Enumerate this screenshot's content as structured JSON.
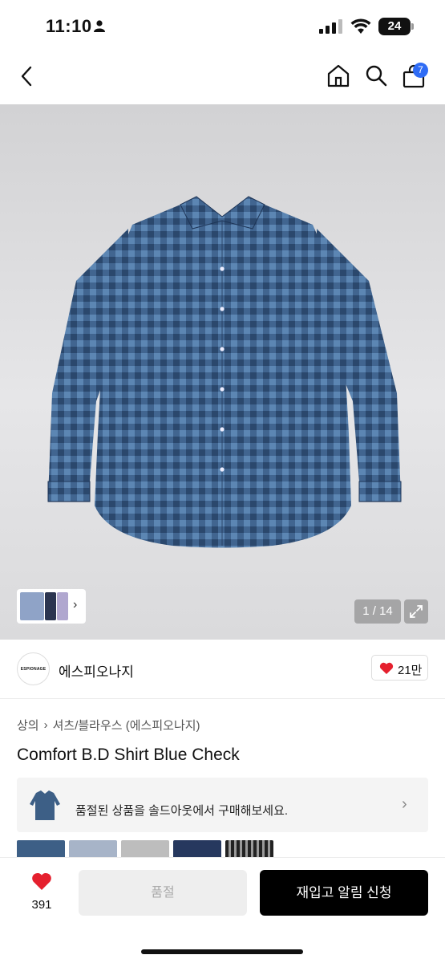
{
  "status_bar": {
    "time": "11:10",
    "battery": "24"
  },
  "nav": {
    "cart_badge": "7"
  },
  "gallery": {
    "counter": "1 / 14"
  },
  "brand": {
    "logo_text": "ESPIONAGE",
    "name": "에스피오나지",
    "likes": "21만"
  },
  "breadcrumb": {
    "level1": "상의",
    "level2": "셔츠/블라우스 (에스피오나지)"
  },
  "product": {
    "title": "Comfort B.D Shirt Blue Check"
  },
  "soldout_banner": {
    "text": "품절된 상품을 솔드아웃에서 구매해보세요."
  },
  "bottom_bar": {
    "wish_count": "391",
    "soldout_label": "품절",
    "restock_label": "재입고 알림 신청"
  },
  "colors": {
    "accent_blue": "#2f6cf5",
    "heart_red": "#e5202e",
    "shirt_blue": "#3d5f86"
  }
}
